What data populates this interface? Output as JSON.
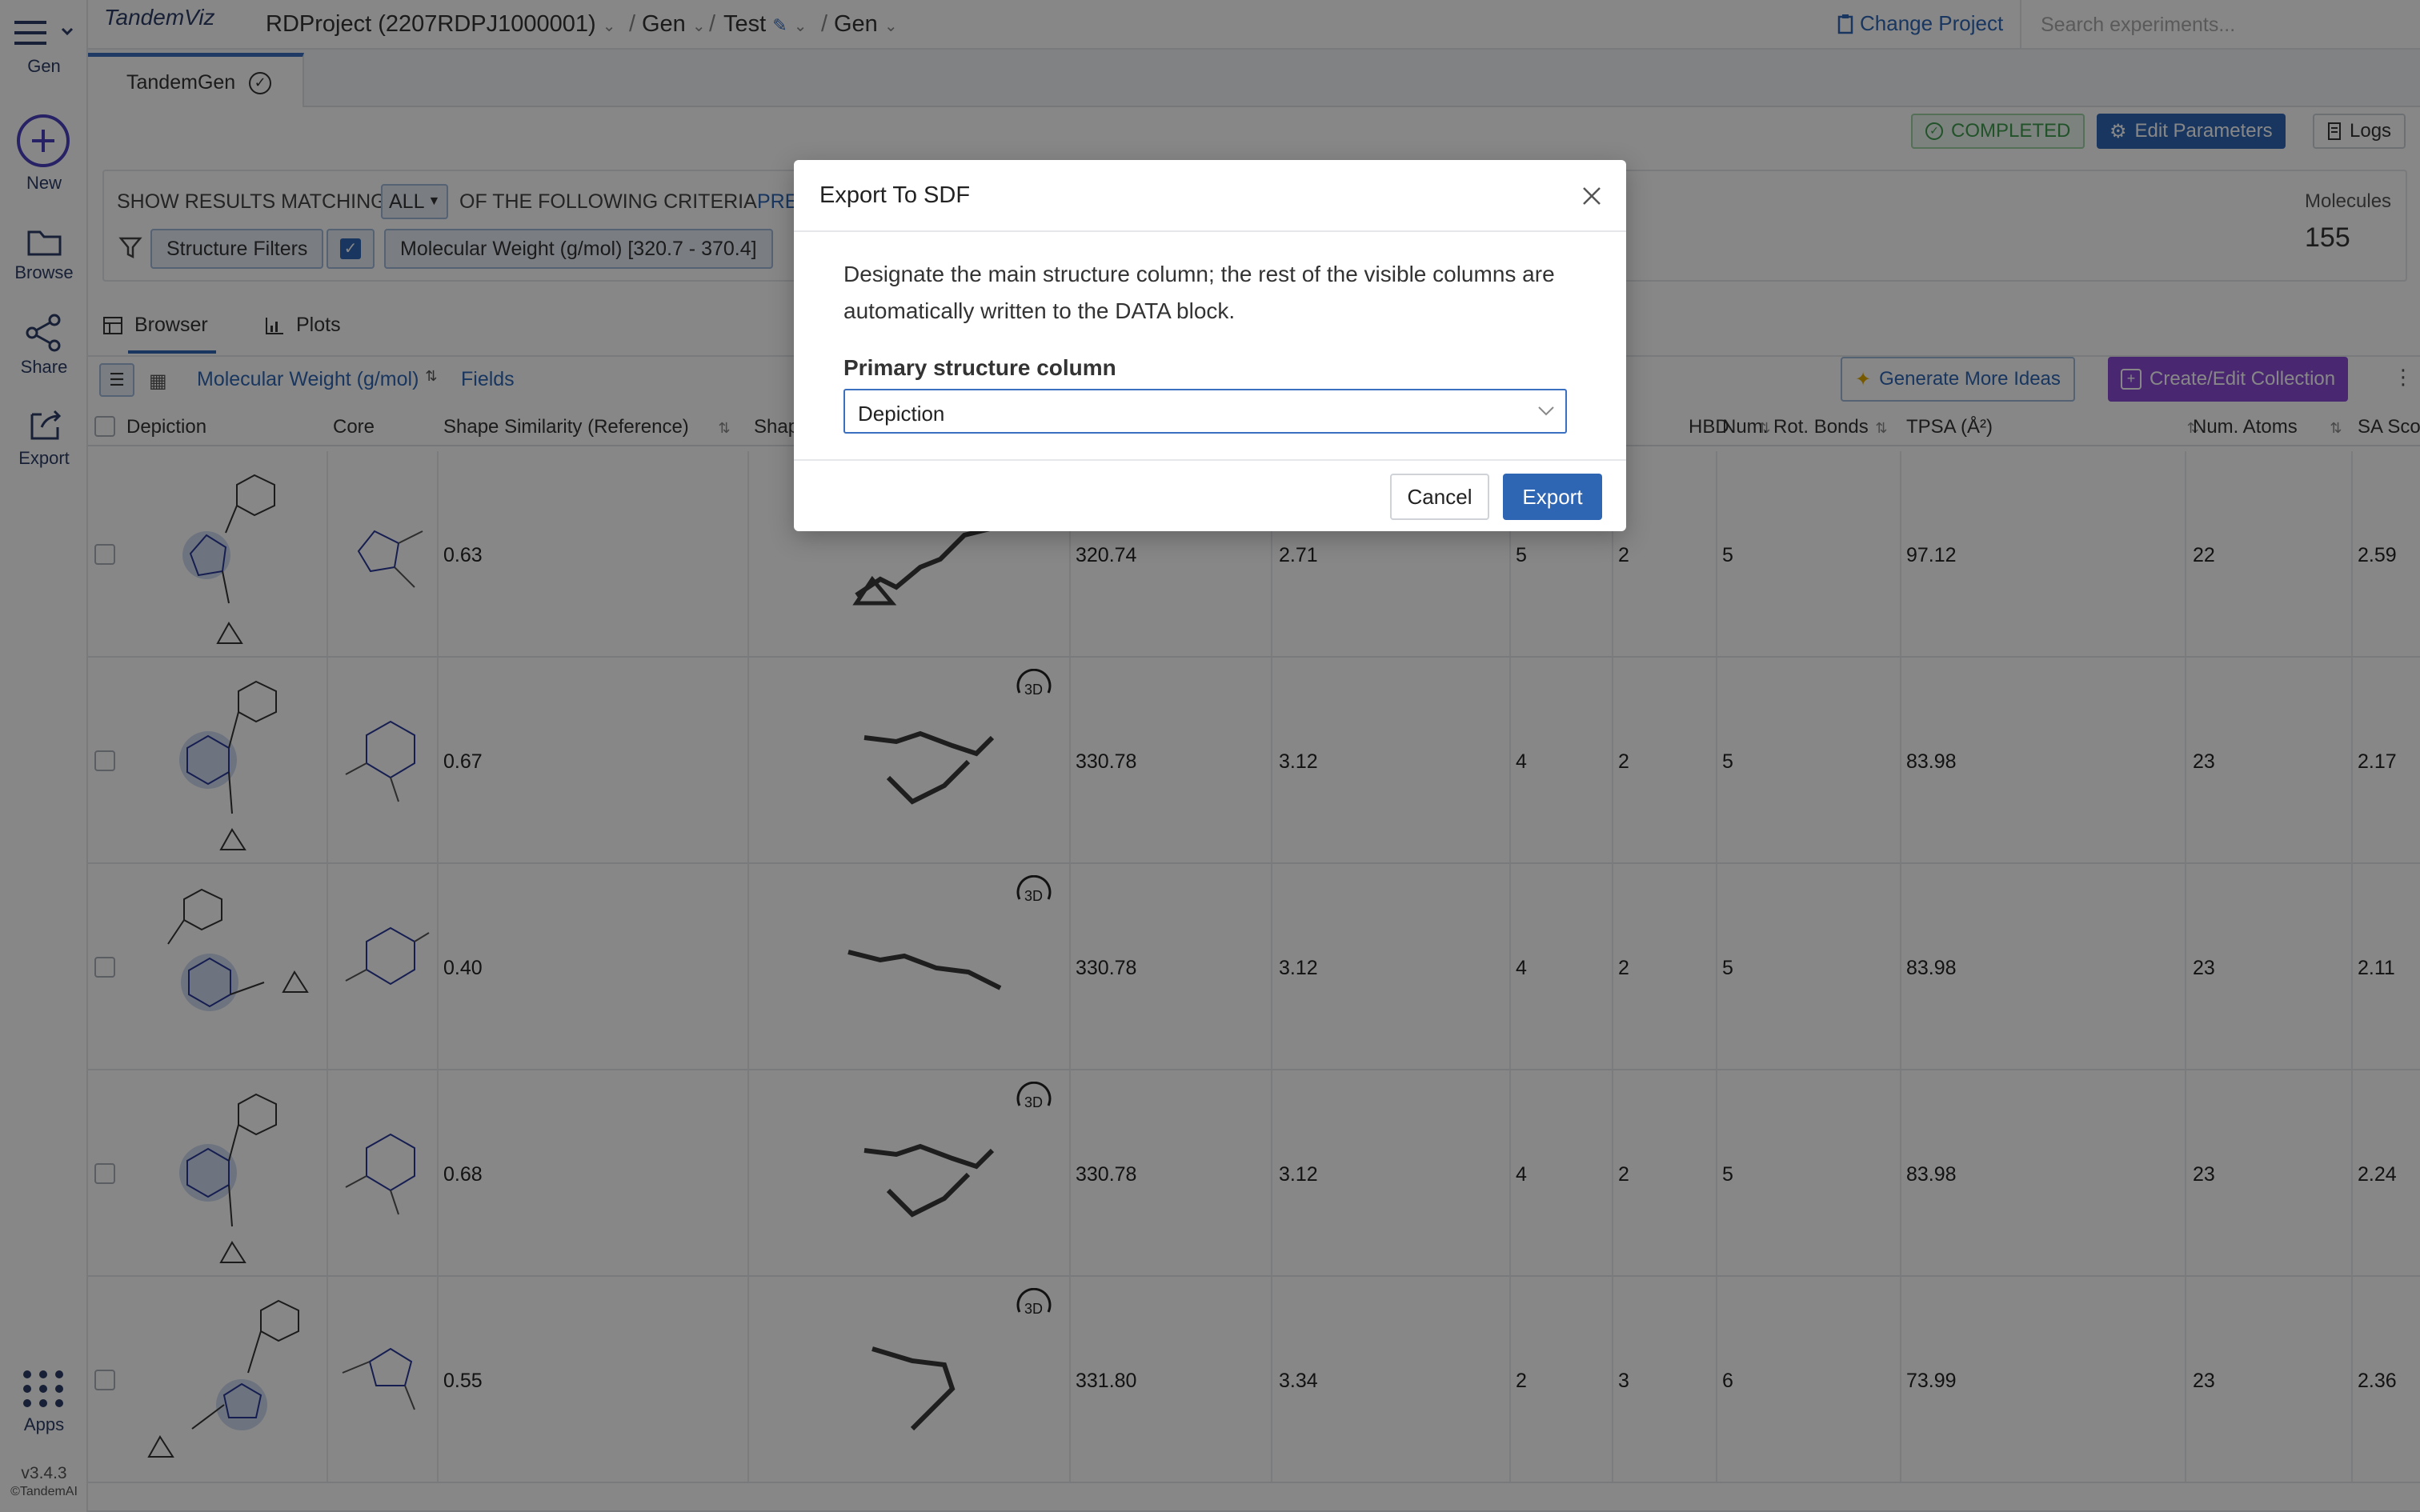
{
  "app": {
    "logo_text": "TandemViz",
    "version": "v3.4.3",
    "copyright": "©TandemAI"
  },
  "rail": {
    "menu_label": "Gen",
    "items": [
      {
        "label": "New",
        "icon": "plus-circle-icon"
      },
      {
        "label": "Browse",
        "icon": "folder-icon"
      },
      {
        "label": "Share",
        "icon": "share-icon"
      },
      {
        "label": "Export",
        "icon": "export-icon"
      }
    ],
    "apps_label": "Apps"
  },
  "breadcrumb": {
    "project": "RDProject (2207RDPJ1000001)",
    "level2": "Gen",
    "level3": "Test",
    "level4": "Gen"
  },
  "header": {
    "change_project": "Change Project",
    "search_placeholder": "Search experiments..."
  },
  "tabs": [
    {
      "label": "TandemGen"
    }
  ],
  "status": {
    "badge": "COMPLETED",
    "edit_parameters": "Edit Parameters",
    "logs": "Logs"
  },
  "filters": {
    "prefix": "SHOW RESULTS MATCHING",
    "mode": "ALL",
    "suffix": "OF THE FOLLOWING CRITERIA",
    "link": "PRE",
    "structure_filters": "Structure Filters",
    "mw_chip": "Molecular Weight (g/mol) [320.7 - 370.4]",
    "molecules_label": "Molecules",
    "molecules_count": "155"
  },
  "view_tabs": {
    "browser": "Browser",
    "plots": "Plots"
  },
  "toolbar": {
    "sort_field": "Molecular Weight (g/mol)",
    "fields": "Fields",
    "generate_more_ideas": "Generate More Ideas",
    "create_edit_collection": "Create/Edit Collection"
  },
  "table": {
    "columns": {
      "depiction": "Depiction",
      "core": "Core",
      "shape_similarity": "Shape Similarity (Reference)",
      "shape": "Shap",
      "hbd": "HBD",
      "rot_bonds": "Num. Rot. Bonds",
      "tpsa": "TPSA (Å²)",
      "atoms": "Num. Atoms",
      "sa": "SA Sco"
    },
    "rows": [
      {
        "sim": "0.63",
        "mw": "320.74",
        "logp": "2.71",
        "hba": "5",
        "hbd": "2",
        "rot": "5",
        "tpsa": "97.12",
        "atoms": "22",
        "sa": "2.59"
      },
      {
        "sim": "0.67",
        "mw": "330.78",
        "logp": "3.12",
        "hba": "4",
        "hbd": "2",
        "rot": "5",
        "tpsa": "83.98",
        "atoms": "23",
        "sa": "2.17"
      },
      {
        "sim": "0.40",
        "mw": "330.78",
        "logp": "3.12",
        "hba": "4",
        "hbd": "2",
        "rot": "5",
        "tpsa": "83.98",
        "atoms": "23",
        "sa": "2.11"
      },
      {
        "sim": "0.68",
        "mw": "330.78",
        "logp": "3.12",
        "hba": "4",
        "hbd": "2",
        "rot": "5",
        "tpsa": "83.98",
        "atoms": "23",
        "sa": "2.24"
      },
      {
        "sim": "0.55",
        "mw": "331.80",
        "logp": "3.34",
        "hba": "2",
        "hbd": "3",
        "rot": "6",
        "tpsa": "73.99",
        "atoms": "23",
        "sa": "2.36"
      }
    ],
    "badge_3d": "3D"
  },
  "modal": {
    "title": "Export To SDF",
    "description": "Designate the main structure column; the rest of the visible columns are automatically written to the DATA block.",
    "primary_label": "Primary structure column",
    "primary_value": "Depiction",
    "cancel": "Cancel",
    "export": "Export"
  },
  "colors": {
    "accent": "#3b6fbf",
    "export_button": "#2f66b3",
    "completed": "#3f9b4f",
    "collection": "#8a4bd6",
    "nav": "#2c3e66"
  }
}
